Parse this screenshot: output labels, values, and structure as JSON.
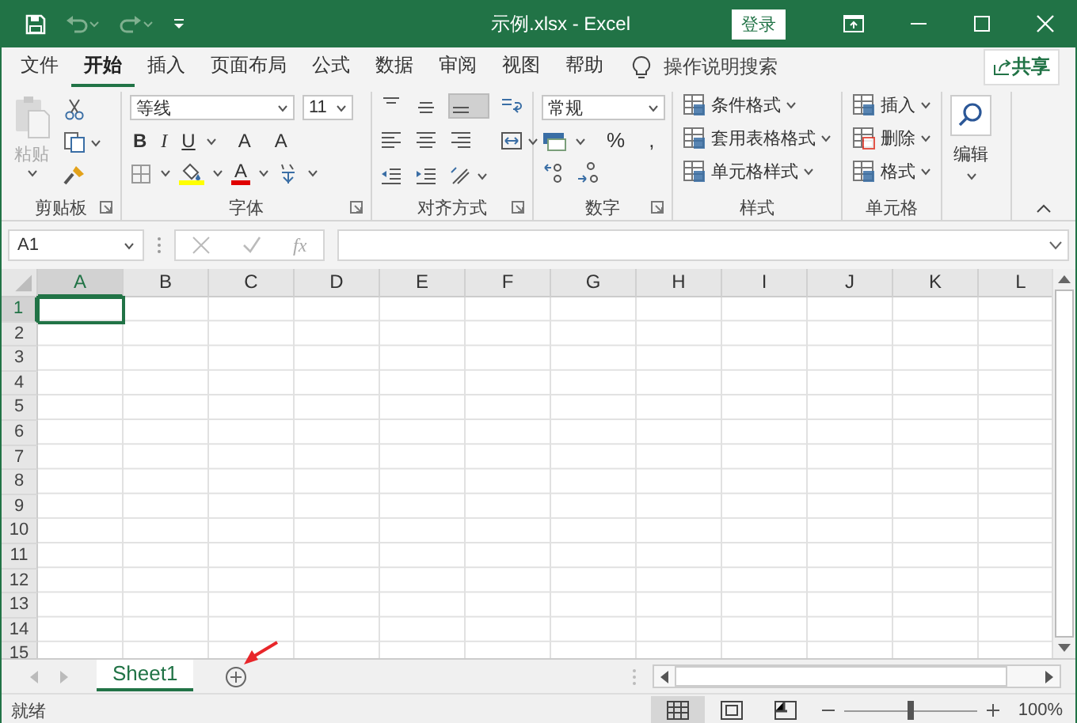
{
  "title_bar": {
    "title": "示例.xlsx - Excel",
    "sign_in": "登录"
  },
  "tabs": [
    {
      "label": "文件",
      "selected": false
    },
    {
      "label": "开始",
      "selected": true
    },
    {
      "label": "插入",
      "selected": false
    },
    {
      "label": "页面布局",
      "selected": false
    },
    {
      "label": "公式",
      "selected": false
    },
    {
      "label": "数据",
      "selected": false
    },
    {
      "label": "审阅",
      "selected": false
    },
    {
      "label": "视图",
      "selected": false
    },
    {
      "label": "帮助",
      "selected": false
    }
  ],
  "tell_me": "操作说明搜索",
  "share": "共享",
  "ribbon": [
    {
      "kind": "clipboard",
      "label": "剪贴板",
      "paste": "粘贴"
    },
    {
      "kind": "font",
      "label": "字体",
      "font_name": "等线",
      "font_size": "11",
      "style_buttons": [
        "B",
        "I",
        "U"
      ],
      "size_buttons": [
        "A",
        "A"
      ],
      "font_color": "A"
    },
    {
      "kind": "alignment",
      "label": "对齐方式"
    },
    {
      "kind": "number",
      "label": "数字",
      "format": "常规",
      "symbols": [
        "%",
        ","
      ]
    },
    {
      "kind": "list",
      "label": "样式",
      "items": [
        "条件格式",
        "套用表格格式",
        "单元格样式"
      ]
    },
    {
      "kind": "list",
      "label": "单元格",
      "items": [
        "插入",
        "删除",
        "格式"
      ]
    },
    {
      "kind": "editing",
      "label": "编辑"
    }
  ],
  "formula_bar": {
    "name_box": "A1",
    "function_label": "fx"
  },
  "columns": [
    {
      "label": "A",
      "selected": true
    },
    {
      "label": "B",
      "selected": false
    },
    {
      "label": "C",
      "selected": false
    },
    {
      "label": "D",
      "selected": false
    },
    {
      "label": "E",
      "selected": false
    },
    {
      "label": "F",
      "selected": false
    },
    {
      "label": "G",
      "selected": false
    },
    {
      "label": "H",
      "selected": false
    },
    {
      "label": "I",
      "selected": false
    },
    {
      "label": "J",
      "selected": false
    },
    {
      "label": "K",
      "selected": false
    },
    {
      "label": "L",
      "selected": false
    }
  ],
  "rows": [
    {
      "label": "1",
      "selected": true
    },
    {
      "label": "2",
      "selected": false
    },
    {
      "label": "3",
      "selected": false
    },
    {
      "label": "4",
      "selected": false
    },
    {
      "label": "5",
      "selected": false
    },
    {
      "label": "6",
      "selected": false
    },
    {
      "label": "7",
      "selected": false
    },
    {
      "label": "8",
      "selected": false
    },
    {
      "label": "9",
      "selected": false
    },
    {
      "label": "10",
      "selected": false
    },
    {
      "label": "11",
      "selected": false
    },
    {
      "label": "12",
      "selected": false
    },
    {
      "label": "13",
      "selected": false
    },
    {
      "label": "14",
      "selected": false
    },
    {
      "label": "15",
      "selected": false
    }
  ],
  "sheets": [
    {
      "name": "Sheet1",
      "selected": true
    }
  ],
  "status_bar": {
    "status": "就绪",
    "views": [
      {
        "kind": "normal",
        "selected": true
      },
      {
        "kind": "page_layout",
        "selected": false
      },
      {
        "kind": "page_break",
        "selected": false
      }
    ],
    "zoom": {
      "level": 0.5,
      "reading": "100%"
    }
  }
}
